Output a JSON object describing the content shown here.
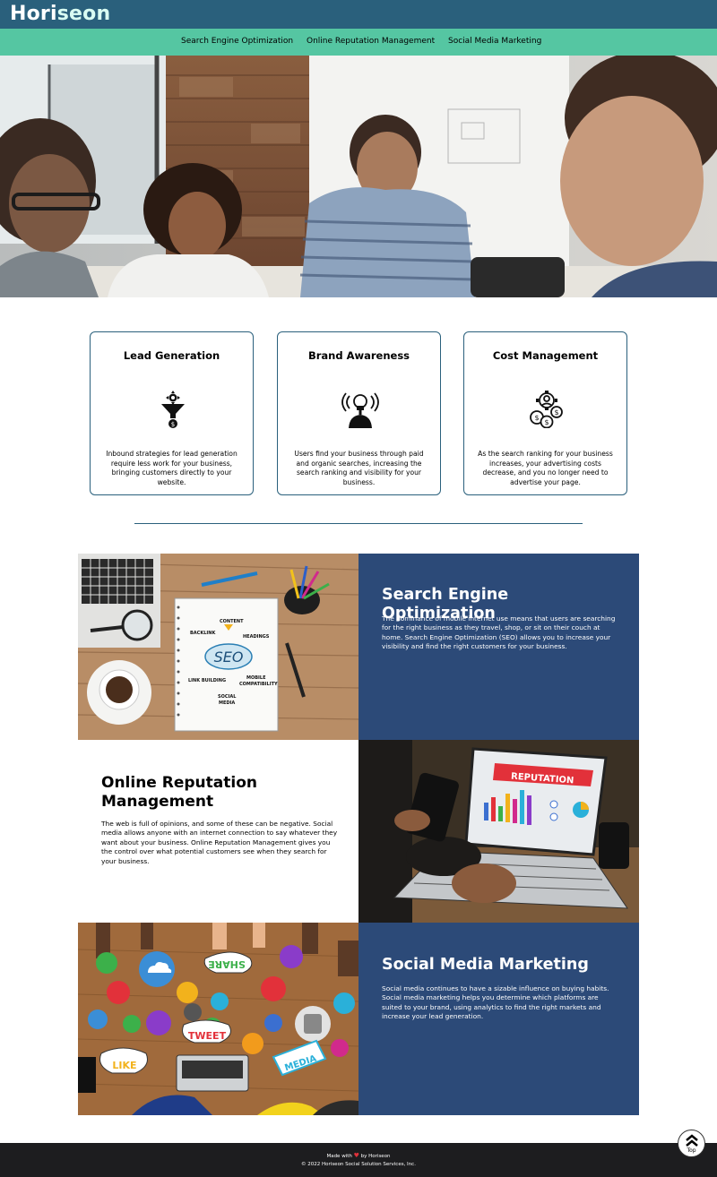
{
  "header": {
    "logo_part1": "Hori",
    "logo_part2": "seon"
  },
  "nav": {
    "items": [
      {
        "label": "Search Engine Optimization"
      },
      {
        "label": "Online Reputation Management"
      },
      {
        "label": "Social Media Marketing"
      }
    ]
  },
  "cards": [
    {
      "title": "Lead Generation",
      "icon": "lead-funnel-icon",
      "text": "Inbound strategies for lead generation require less work for your business, bringing customers directly to your website."
    },
    {
      "title": "Brand Awareness",
      "icon": "brand-broadcast-icon",
      "text": "Users find your business through paid and organic searches, increasing the search ranking and visibility for your business."
    },
    {
      "title": "Cost Management",
      "icon": "cost-coins-icon",
      "text": "As the search ranking for your business increases, your advertising costs decrease, and you no longer need to advertise your page."
    }
  ],
  "sections": {
    "seo": {
      "title": "Search Engine Optimization",
      "text": "The dominance of mobile internet use means that users are searching for the right business as they travel, shop, or sit on their couch at home. Search Engine Optimization (SEO) allows you to increase your visibility and find the right customers for your business.",
      "image_words": {
        "content": "CONTENT",
        "backlink": "BACKLINK",
        "headings": "HEADINGS",
        "seo": "SEO",
        "link_building": "LINK BUILDING",
        "mobile": "MOBILE",
        "compatibility": "COMPATIBILITY",
        "social": "SOCIAL",
        "media": "MEDIA"
      }
    },
    "reputation": {
      "title_line1": "Online Reputation",
      "title_line2": "Management",
      "text": "The web is full of opinions, and some of these can be negative. Social media allows anyone with an internet connection to say whatever they want about your business. Online Reputation Management gives you the control over what potential customers see when they search for your business.",
      "image_words": {
        "banner": "REPUTATION"
      }
    },
    "social": {
      "title": "Social Media Marketing",
      "text": "Social media continues to have a sizable influence on buying habits. Social media marketing helps you determine which platforms are suited to your brand, using analytics to find the right markets and increase your lead generation.",
      "image_words": {
        "share": "SHARE",
        "tweet": "TWEET",
        "like": "LIKE",
        "media": "MEDIA"
      }
    }
  },
  "footer": {
    "made_with": "Made with",
    "heart": "♥",
    "by": "by Horiseon",
    "copyright": "© 2022 Horiseon Social Solution Services, Inc."
  },
  "top_button": {
    "label": "Top"
  },
  "colors": {
    "header_bg": "#2a607c",
    "nav_bg": "#55c6a2",
    "section_dark": "#2c4a78",
    "footer_bg": "#1d1d1f"
  }
}
